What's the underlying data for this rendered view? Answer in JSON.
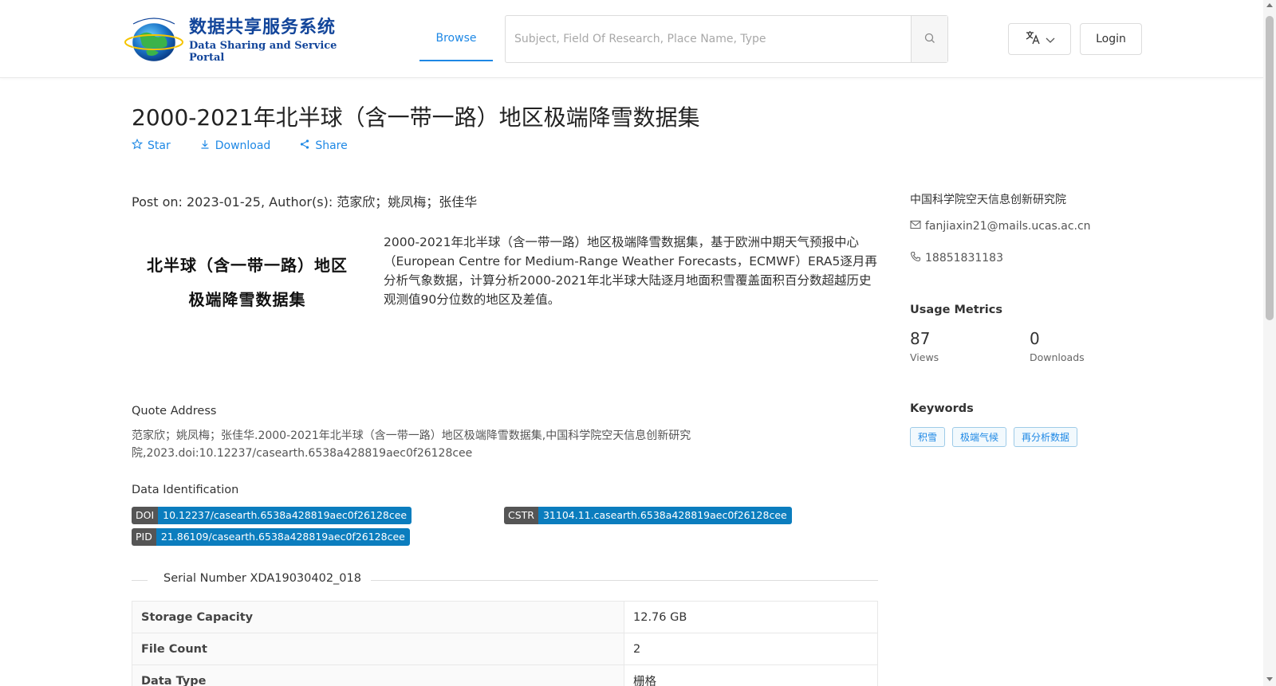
{
  "header": {
    "logo_cn": "数据共享服务系统",
    "logo_en": "Data Sharing and Service Portal",
    "nav_browse": "Browse",
    "search_placeholder": "Subject, Field Of Research, Place Name, Type",
    "login_label": "Login",
    "colors": {
      "brand": "#12459a",
      "accent": "#1e88e5"
    }
  },
  "dataset": {
    "title": "2000-2021年北半球（含一带一路）地区极端降雪数据集",
    "actions": {
      "star": "Star",
      "download": "Download",
      "share": "Share"
    },
    "post_info": "Post on: 2023-01-25, Author(s): 范家欣；姚凤梅；张佳华",
    "cover": {
      "line1": "北半球（含一带一路）地区",
      "line2": "极端降雪数据集"
    },
    "description": "2000-2021年北半球（含一带一路）地区极端降雪数据集，基于欧洲中期天气预报中心（European Centre for Medium-Range Weather Forecasts，ECMWF）ERA5逐月再分析气象数据，计算分析2000-2021年北半球大陆逐月地面积雪覆盖面积百分数超越历史观测值90分位数的地区及差值。",
    "quote_label": "Quote Address",
    "quote": "范家欣；姚凤梅；张佳华.2000-2021年北半球（含一带一路）地区极端降雪数据集,中国科学院空天信息创新研究院,2023.doi:10.12237/casearth.6538a428819aec0f26128cee",
    "identification_label": "Data Identification",
    "identifiers": {
      "doi": {
        "key": "DOI",
        "value": "10.12237/casearth.6538a428819aec0f26128cee"
      },
      "cstr": {
        "key": "CSTR",
        "value": "31104.11.casearth.6538a428819aec0f26128cee"
      },
      "pid": {
        "key": "PID",
        "value": "21.86109/casearth.6538a428819aec0f26128cee"
      }
    },
    "serial": "Serial Number XDA19030402_018",
    "table": [
      {
        "key": "Storage Capacity",
        "value": "12.76 GB"
      },
      {
        "key": "File Count",
        "value": "2"
      },
      {
        "key": "Data Type",
        "value": "栅格"
      }
    ]
  },
  "sidebar": {
    "org": "中国科学院空天信息创新研究院",
    "email": "fanjiaxin21@mails.ucas.ac.cn",
    "phone": "18851831183",
    "usage_heading": "Usage Metrics",
    "views": {
      "value": "87",
      "label": "Views"
    },
    "downloads": {
      "value": "0",
      "label": "Downloads"
    },
    "keywords_heading": "Keywords",
    "keywords": [
      "积雪",
      "极端气候",
      "再分析数据"
    ]
  }
}
